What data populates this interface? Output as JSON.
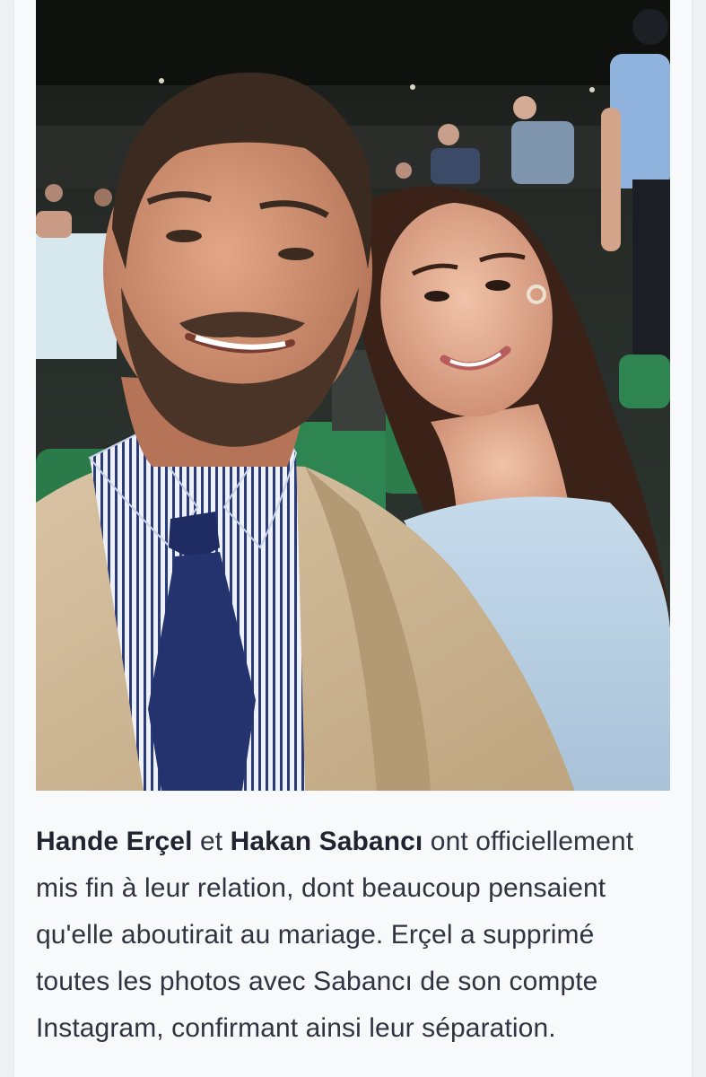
{
  "article": {
    "caption": {
      "name1": "Hande Erçel",
      "join": " et ",
      "name2": "Hakan Sabancı",
      "rest": " ont officiellement mis fin à leur relation, dont beaucoup pensaient qu'elle aboutirait au mariage. Erçel a supprimé toutes les photos avec Sabancı de son compte Instagram, confirmant ainsi leur séparation."
    }
  }
}
